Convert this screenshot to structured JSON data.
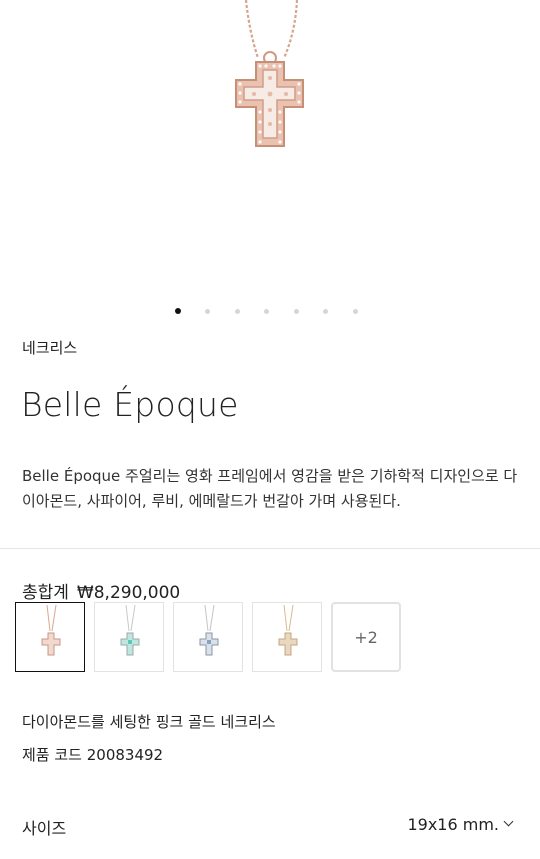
{
  "product": {
    "category": "네크리스",
    "title": "Belle Époque",
    "description": "Belle Époque 주얼리는 영화 프레임에서 영감을 받은 기하학적 디자인으로 다이아몬드, 사파이어, 루비, 에메랄드가 번갈아 가며 사용된다.",
    "total_label": "총합계",
    "price": "₩8,290,000",
    "more_variants": "+2",
    "variant_name": "다이아몬드를 세팅한 핑크 골드 네크리스",
    "code_label": "제품 코드",
    "code_value": "20083492",
    "size_label": "사이즈",
    "size_value": "19x16 mm."
  },
  "gallery": {
    "slide_count": 7,
    "active_index": 0
  },
  "variants": [
    {
      "icon": "pink-gold-diamond-cross-icon",
      "chain": "#d7a88f",
      "stone": "#f1d9cf",
      "selected": true
    },
    {
      "icon": "white-gold-emerald-cross-icon",
      "chain": "#c8c8c8",
      "stone": "#5ec7b8",
      "selected": false
    },
    {
      "icon": "white-gold-sapphire-cross-icon",
      "chain": "#c4c4c4",
      "stone": "#8aa3b8",
      "selected": false
    },
    {
      "icon": "yellow-gold-diamond-cross-icon",
      "chain": "#d9b98f",
      "stone": "#e9d7bf",
      "selected": false
    }
  ],
  "colors": {
    "rose_gold": "#d9a48e",
    "accent": "#111111"
  }
}
